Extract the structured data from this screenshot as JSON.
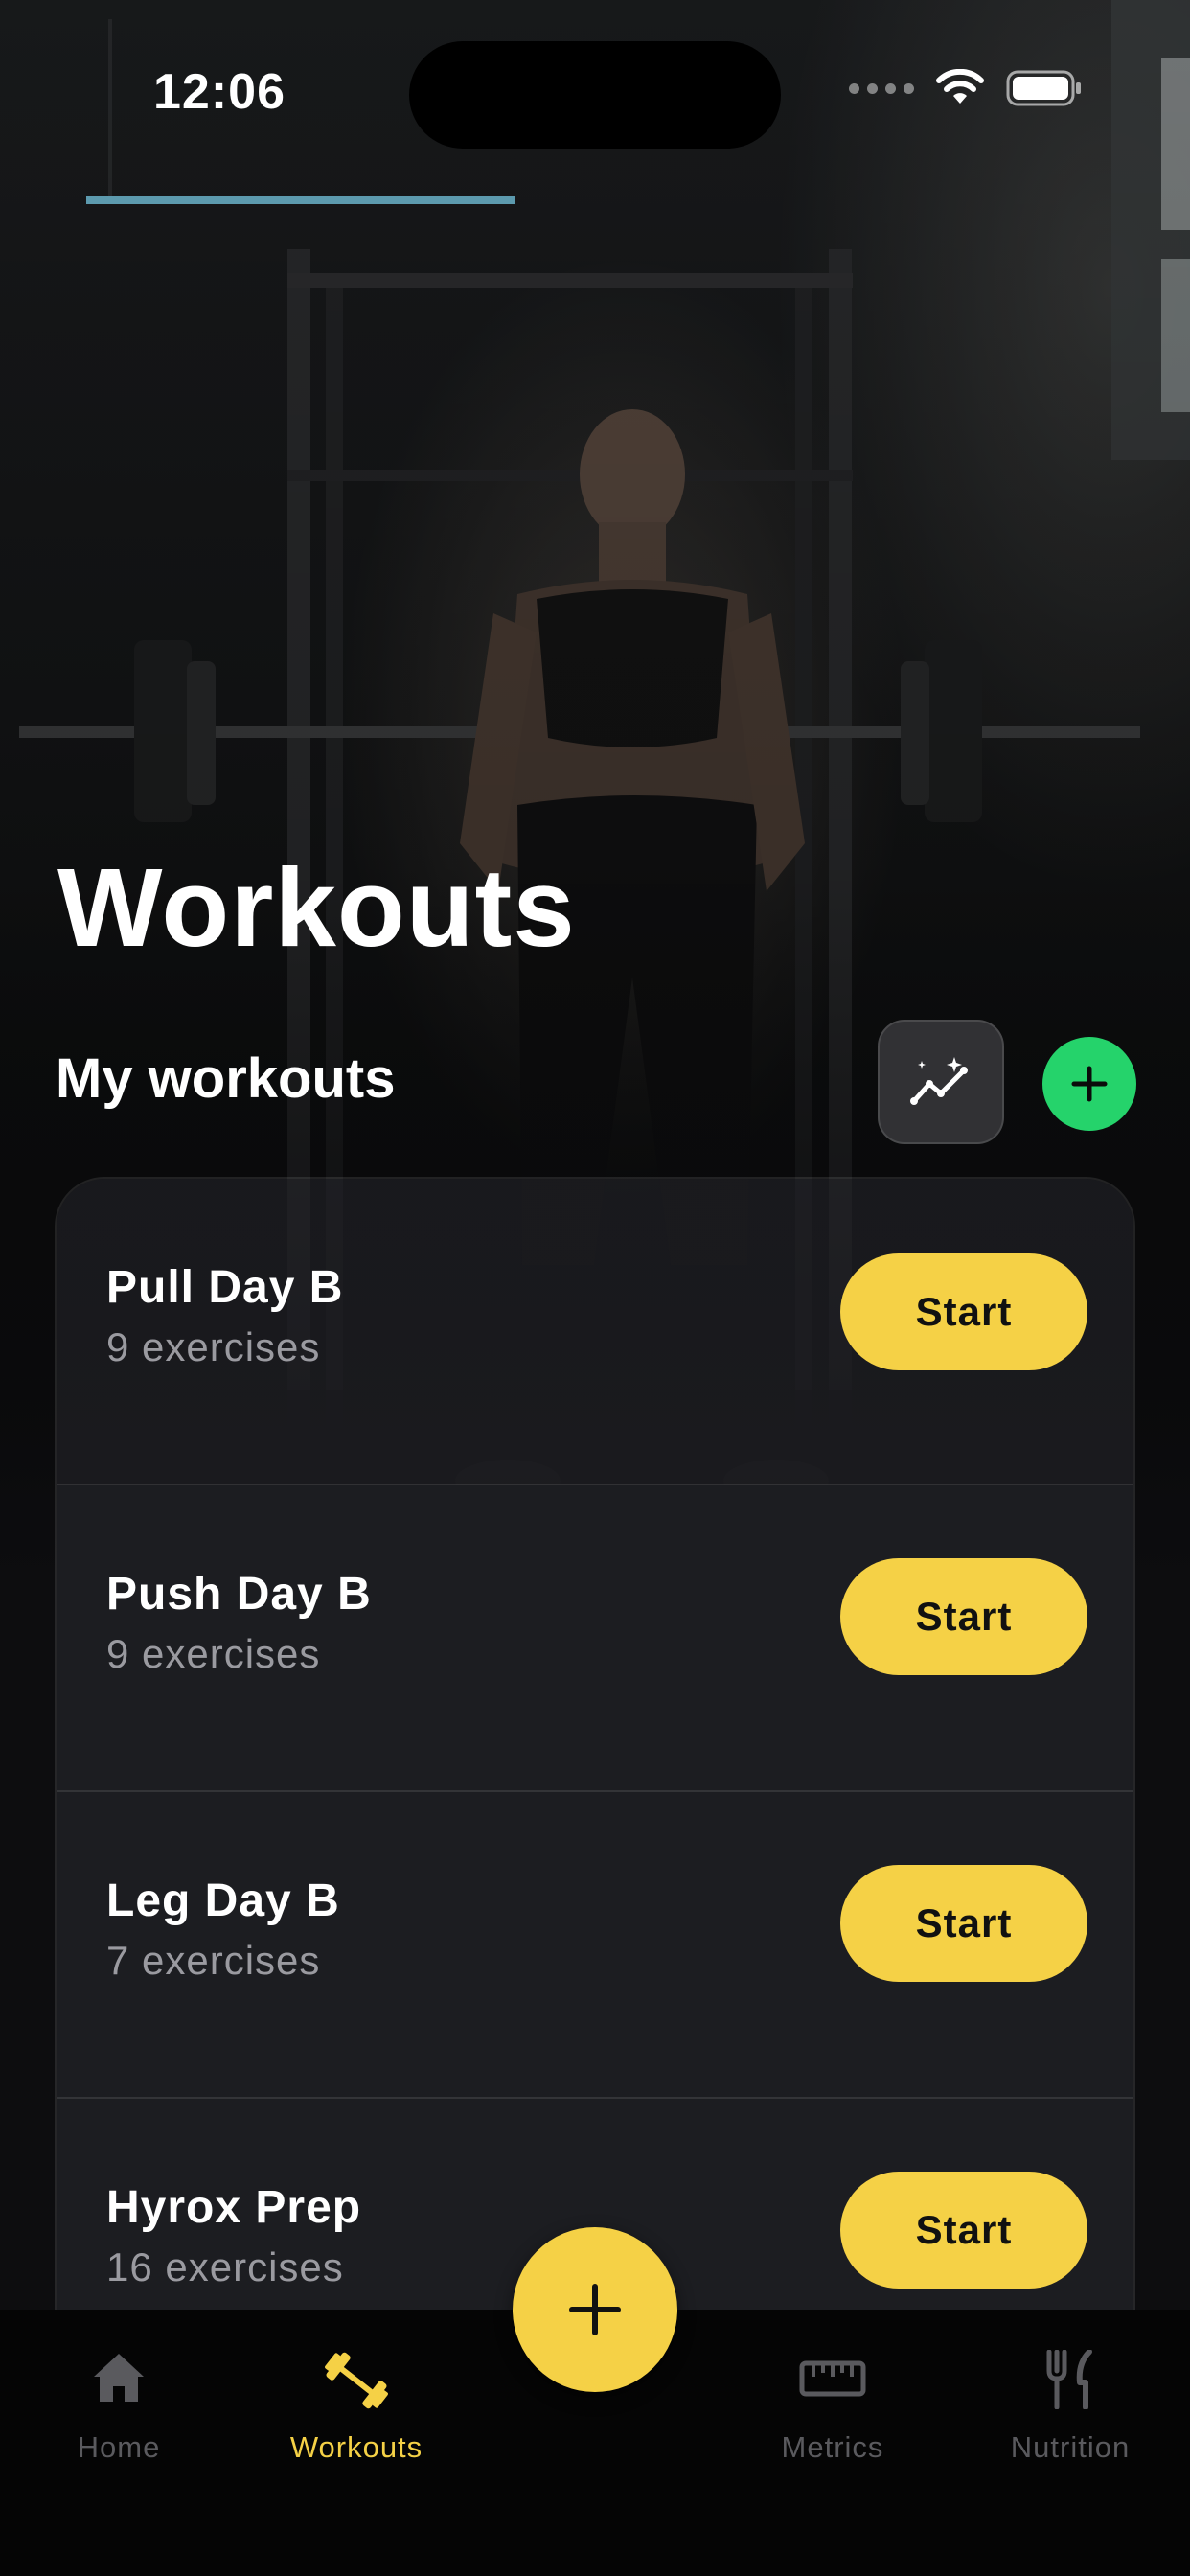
{
  "status_bar": {
    "time": "12:06"
  },
  "header": {
    "title": "Workouts",
    "section_title": "My workouts",
    "icons": {
      "stats": "sparkle-chart-icon",
      "add": "plus-icon"
    }
  },
  "workouts": [
    {
      "name": "Pull Day B",
      "exercises": "9 exercises",
      "action": "Start"
    },
    {
      "name": "Push Day B",
      "exercises": "9 exercises",
      "action": "Start"
    },
    {
      "name": "Leg Day B",
      "exercises": "7 exercises",
      "action": "Start"
    },
    {
      "name": "Hyrox Prep",
      "exercises": "16 exercises",
      "action": "Start"
    }
  ],
  "tab_bar": {
    "items": [
      {
        "label": "Home",
        "icon": "house-icon",
        "active": false
      },
      {
        "label": "Workouts",
        "icon": "dumbbell-icon",
        "active": true
      },
      {
        "label": "Metrics",
        "icon": "ruler-icon",
        "active": false
      },
      {
        "label": "Nutrition",
        "icon": "fork-knife-icon",
        "active": false
      }
    ],
    "fab_icon": "plus-icon"
  },
  "colors": {
    "accent": "#f5d146",
    "add_button": "#25d36b",
    "background": "#0d0d0f",
    "card": "#1c1d21",
    "muted_text": "#9a9aa0",
    "inactive_tab": "#5a5a5e"
  }
}
